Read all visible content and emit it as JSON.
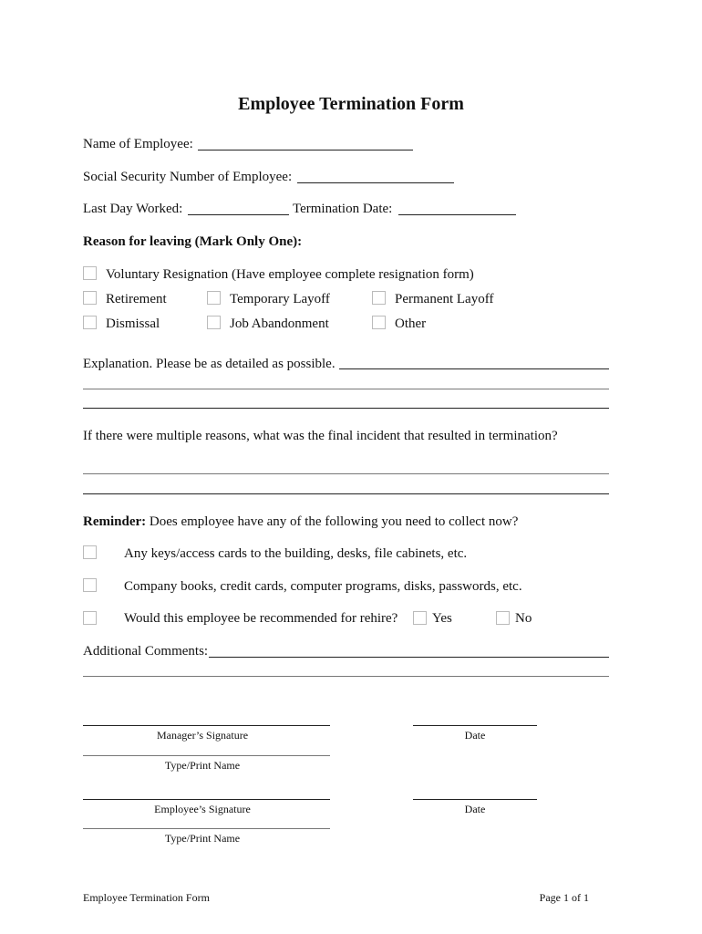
{
  "title": "Employee Termination Form",
  "fields": {
    "name_label": "Name of Employee:",
    "ssn_label": "Social Security Number of Employee:",
    "last_day_label": "Last Day Worked:",
    "termination_date_label": "Termination Date:"
  },
  "reason": {
    "heading": "Reason for leaving (Mark Only One):",
    "options": [
      {
        "label": "Voluntary Resignation (Have employee complete resignation form)",
        "checked": false
      },
      {
        "label": "Retirement",
        "checked": false
      },
      {
        "label": "Temporary Layoff",
        "checked": false
      },
      {
        "label": "Permanent Layoff",
        "checked": false
      },
      {
        "label": "Dismissal",
        "checked": false
      },
      {
        "label": "Job Abandonment",
        "checked": false
      },
      {
        "label": "Other",
        "checked": false
      }
    ]
  },
  "explanation": {
    "label": "Explanation. Please be as detailed as possible."
  },
  "final_incident": {
    "question": "If there were multiple reasons, what was the final incident that resulted in termination?"
  },
  "reminder": {
    "bold_label": "Reminder:",
    "text": "Does employee have any of the following you need to collect now?",
    "items": [
      {
        "label": "Any keys/access cards to the building, desks, file cabinets, etc.",
        "checked": false
      },
      {
        "label": "Company books, credit cards, computer programs, disks, passwords, etc.",
        "checked": false
      },
      {
        "label": "Would this employee be recommended for rehire?",
        "checked": false
      }
    ],
    "rehire_yes": "Yes",
    "rehire_no": "No"
  },
  "comments": {
    "label": "Additional Comments:"
  },
  "signatures": {
    "manager_signature": "Manager’s Signature",
    "manager_print": "Type/Print Name",
    "manager_date": "Date",
    "employee_signature": "Employee’s Signature",
    "employee_print": "Type/Print Name",
    "employee_date": "Date"
  },
  "footer": {
    "left": "Employee Termination Form",
    "right": "Page 1 of 1"
  }
}
